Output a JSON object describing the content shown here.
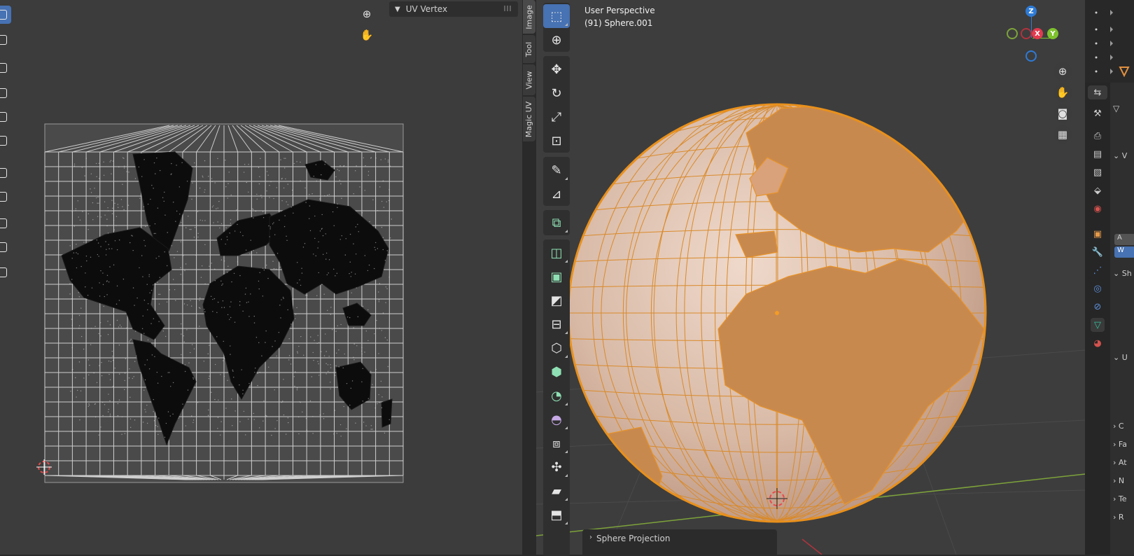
{
  "uv_editor": {
    "panel_title": "UV Vertex",
    "side_tabs": [
      "Image",
      "Tool",
      "View",
      "Magic UV"
    ],
    "nav_icons": [
      "zoom-icon",
      "hand-icon"
    ]
  },
  "viewport": {
    "view_name": "User Perspective",
    "object_name": "(91) Sphere.001",
    "gizmo_axes": [
      "Z",
      "X",
      "Y"
    ],
    "last_operator": "Sphere Projection",
    "nav_icons": [
      "zoom-icon",
      "hand-icon",
      "camera-icon",
      "grid-icon"
    ],
    "colors": {
      "mesh": "#e8901c",
      "selected_face": "#c38a5a",
      "active_tool": "#4772b3",
      "axis_x": "#e23a4f",
      "axis_y": "#7ec22d",
      "axis_z": "#2e7bd6"
    }
  },
  "properties": {
    "labels": [
      "V",
      "Sh",
      "U",
      "C",
      "Fa",
      "At",
      "N",
      "Te",
      "R"
    ],
    "button_labels": [
      "A",
      "W"
    ]
  }
}
